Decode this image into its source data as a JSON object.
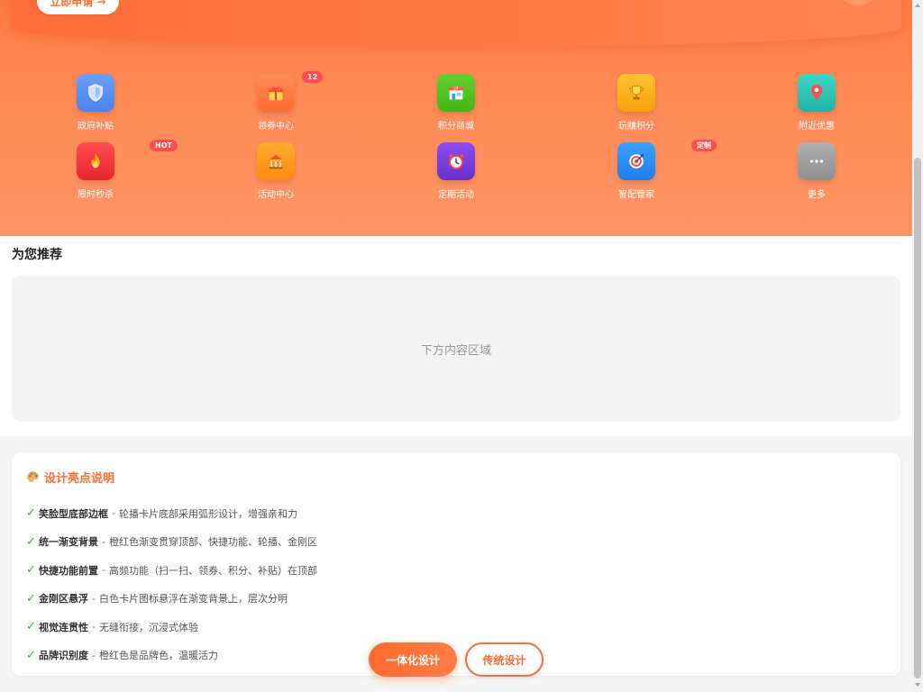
{
  "banner": {
    "apply_label": "立即申请 →"
  },
  "colors": {
    "brand": "#ff6a2e",
    "check": "#3aa84a",
    "badge": "#ff4d4f"
  },
  "grid": {
    "items": [
      {
        "label": "政府补贴",
        "icon": "shield-icon",
        "color": "#5b8ff0"
      },
      {
        "label": "领券中心",
        "icon": "gift-icon",
        "color": "#ff7a45",
        "badge": "12"
      },
      {
        "label": "积分商城",
        "icon": "store-icon",
        "color": "#52c41a"
      },
      {
        "label": "玩赚积分",
        "icon": "trophy-icon",
        "color": "#fab012"
      },
      {
        "label": "附近优惠",
        "icon": "location-pin-icon",
        "color": "#2ec5b6"
      },
      {
        "label": "限时秒杀",
        "icon": "fire-icon",
        "color": "#f5303a",
        "badge": "HOT"
      },
      {
        "label": "活动中心",
        "icon": "carousel-icon",
        "color": "#ff9a1f"
      },
      {
        "label": "定期活动",
        "icon": "alarm-clock-icon",
        "color": "#7b3fd6"
      },
      {
        "label": "智配管家",
        "icon": "target-icon",
        "color": "#2f8ff0",
        "badge": "定制"
      },
      {
        "label": "更多",
        "icon": "more-dots-icon",
        "color": "#9e9e9e"
      }
    ]
  },
  "recommend": {
    "title": "为您推荐",
    "placeholder": "下方内容区域"
  },
  "highlights": {
    "title": "设计亮点说明",
    "icon": "palette-icon",
    "points": [
      {
        "check": "✓",
        "title": "笑脸型底部边框",
        "sep": "-",
        "desc": "轮播卡片底部采用弧形设计，增强亲和力"
      },
      {
        "check": "✓",
        "title": "统一渐变背景",
        "sep": "-",
        "desc": "橙红色渐变贯穿顶部、快捷功能、轮播、金刚区"
      },
      {
        "check": "✓",
        "title": "快捷功能前置",
        "sep": "-",
        "desc": "高频功能（扫一扫、领券、积分、补贴）在顶部"
      },
      {
        "check": "✓",
        "title": "金刚区悬浮",
        "sep": "-",
        "desc": "白色卡片图标悬浮在渐变背景上，层次分明"
      },
      {
        "check": "✓",
        "title": "视觉连贯性",
        "sep": "-",
        "desc": "无缝衔接，沉浸式体验"
      },
      {
        "check": "✓",
        "title": "品牌识别度",
        "sep": "-",
        "desc": "橙红色是品牌色，温暖活力"
      }
    ]
  },
  "actions": {
    "primary_label": "一体化设计",
    "secondary_label": "传统设计"
  }
}
